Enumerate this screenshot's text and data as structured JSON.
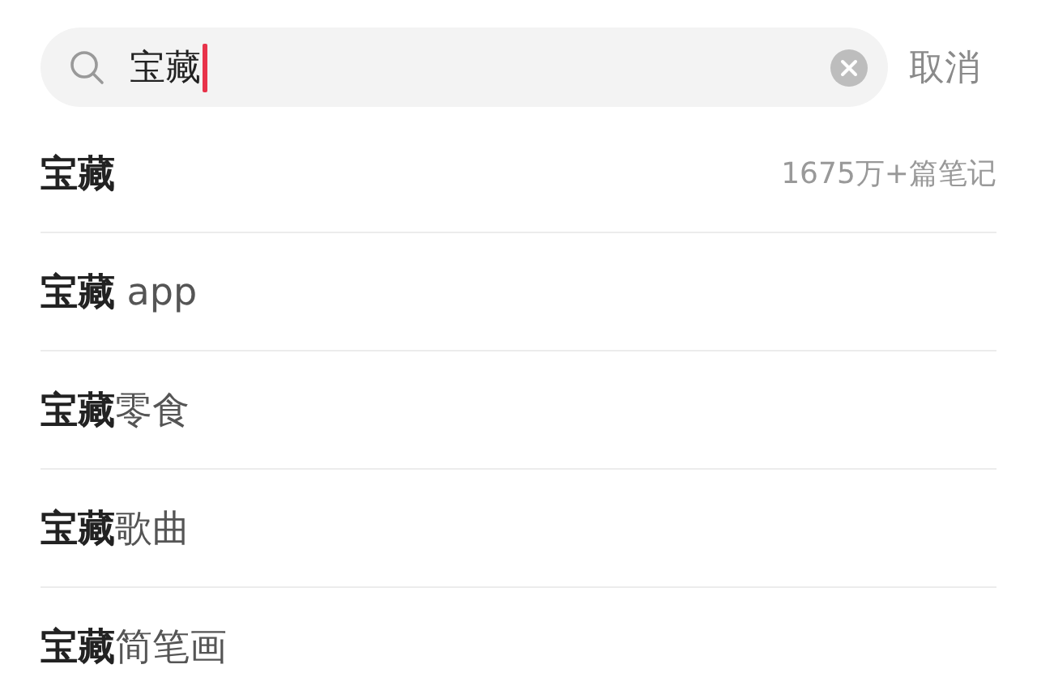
{
  "search": {
    "value": "宝藏",
    "cancel": "取消"
  },
  "suggestions": [
    {
      "text": "**宝藏**",
      "count": "1675万+篇笔记"
    },
    {
      "text": "**宝藏** app"
    },
    {
      "text": "**宝藏**零食"
    },
    {
      "text": "**宝藏**歌曲"
    },
    {
      "text": "**宝藏**简笔画"
    }
  ]
}
